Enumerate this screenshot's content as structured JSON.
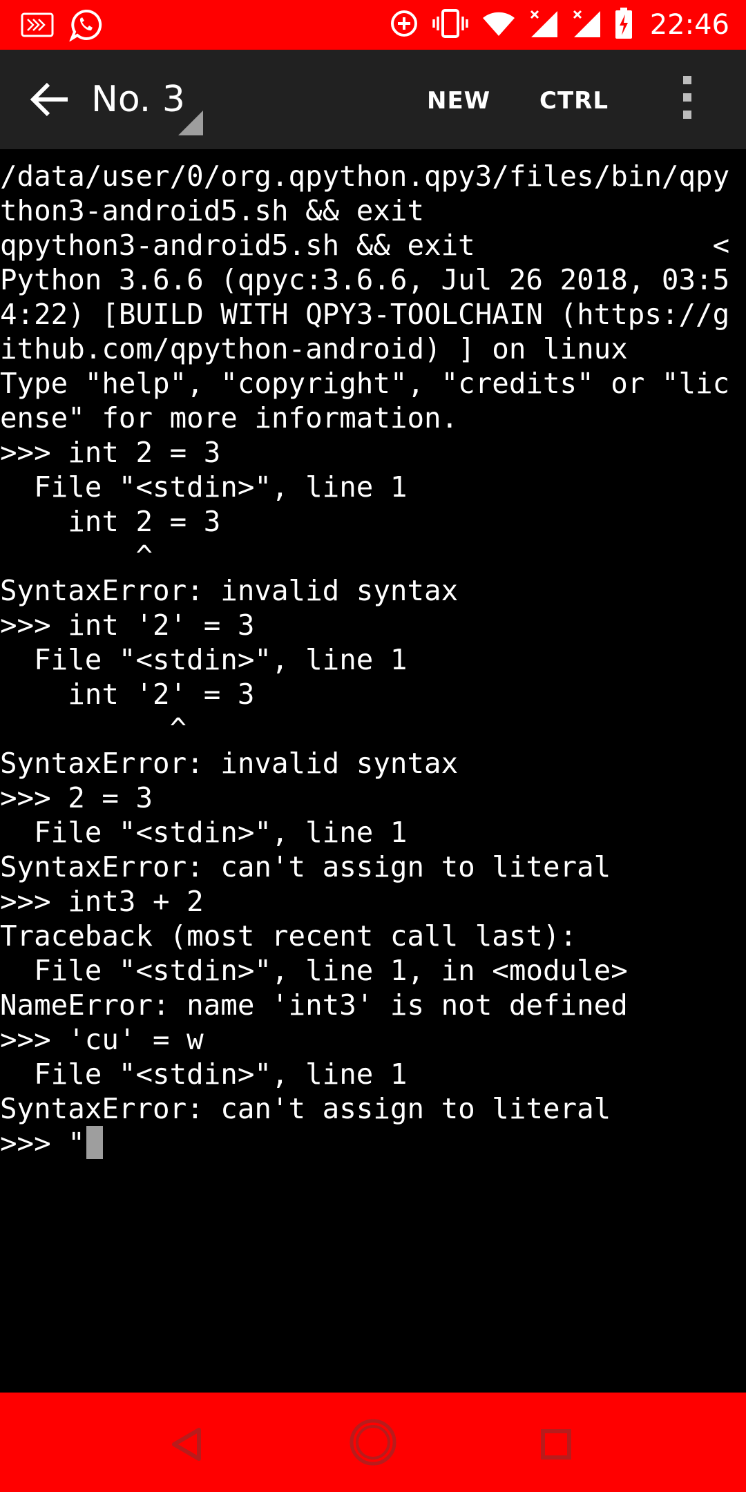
{
  "status_bar": {
    "time": "22:46",
    "icons": [
      "screen-mirror-icon",
      "whatsapp-icon",
      "data-saver-icon",
      "vibrate-icon",
      "wifi-icon",
      "signal-icon",
      "signal-icon",
      "battery-charging-icon"
    ]
  },
  "app_bar": {
    "title": "No. 3",
    "actions": {
      "new_label": "NEW",
      "ctrl_label": "CTRL"
    }
  },
  "terminal": {
    "lines": [
      "/data/user/0/org.qpython.qpy3/files/bin/qpy",
      "thon3-android5.sh && exit",
      "qpython3-android5.sh && exit              <",
      "Python 3.6.6 (qpyc:3.6.6, Jul 26 2018, 03:5",
      "4:22) [BUILD WITH QPY3-TOOLCHAIN (https://g",
      "ithub.com/qpython-android) ] on linux",
      "Type \"help\", \"copyright\", \"credits\" or \"lic",
      "ense\" for more information.",
      ">>> int 2 = 3",
      "  File \"<stdin>\", line 1",
      "    int 2 = 3",
      "        ^",
      "SyntaxError: invalid syntax",
      ">>> int '2' = 3",
      "  File \"<stdin>\", line 1",
      "    int '2' = 3",
      "          ^",
      "SyntaxError: invalid syntax",
      ">>> 2 = 3",
      "  File \"<stdin>\", line 1",
      "SyntaxError: can't assign to literal",
      ">>> int3 + 2",
      "Traceback (most recent call last):",
      "  File \"<stdin>\", line 1, in <module>",
      "NameError: name 'int3' is not defined",
      ">>> 'cu' = w",
      "  File \"<stdin>\", line 1",
      "SyntaxError: can't assign to literal"
    ],
    "prompt_line": ">>> \""
  },
  "colors": {
    "status_bar": "#ff0000",
    "app_bar": "#212121",
    "terminal_bg": "#000000",
    "terminal_text": "#ffffff",
    "cursor": "#9e9e9e",
    "nav_bar": "#ff0000"
  }
}
